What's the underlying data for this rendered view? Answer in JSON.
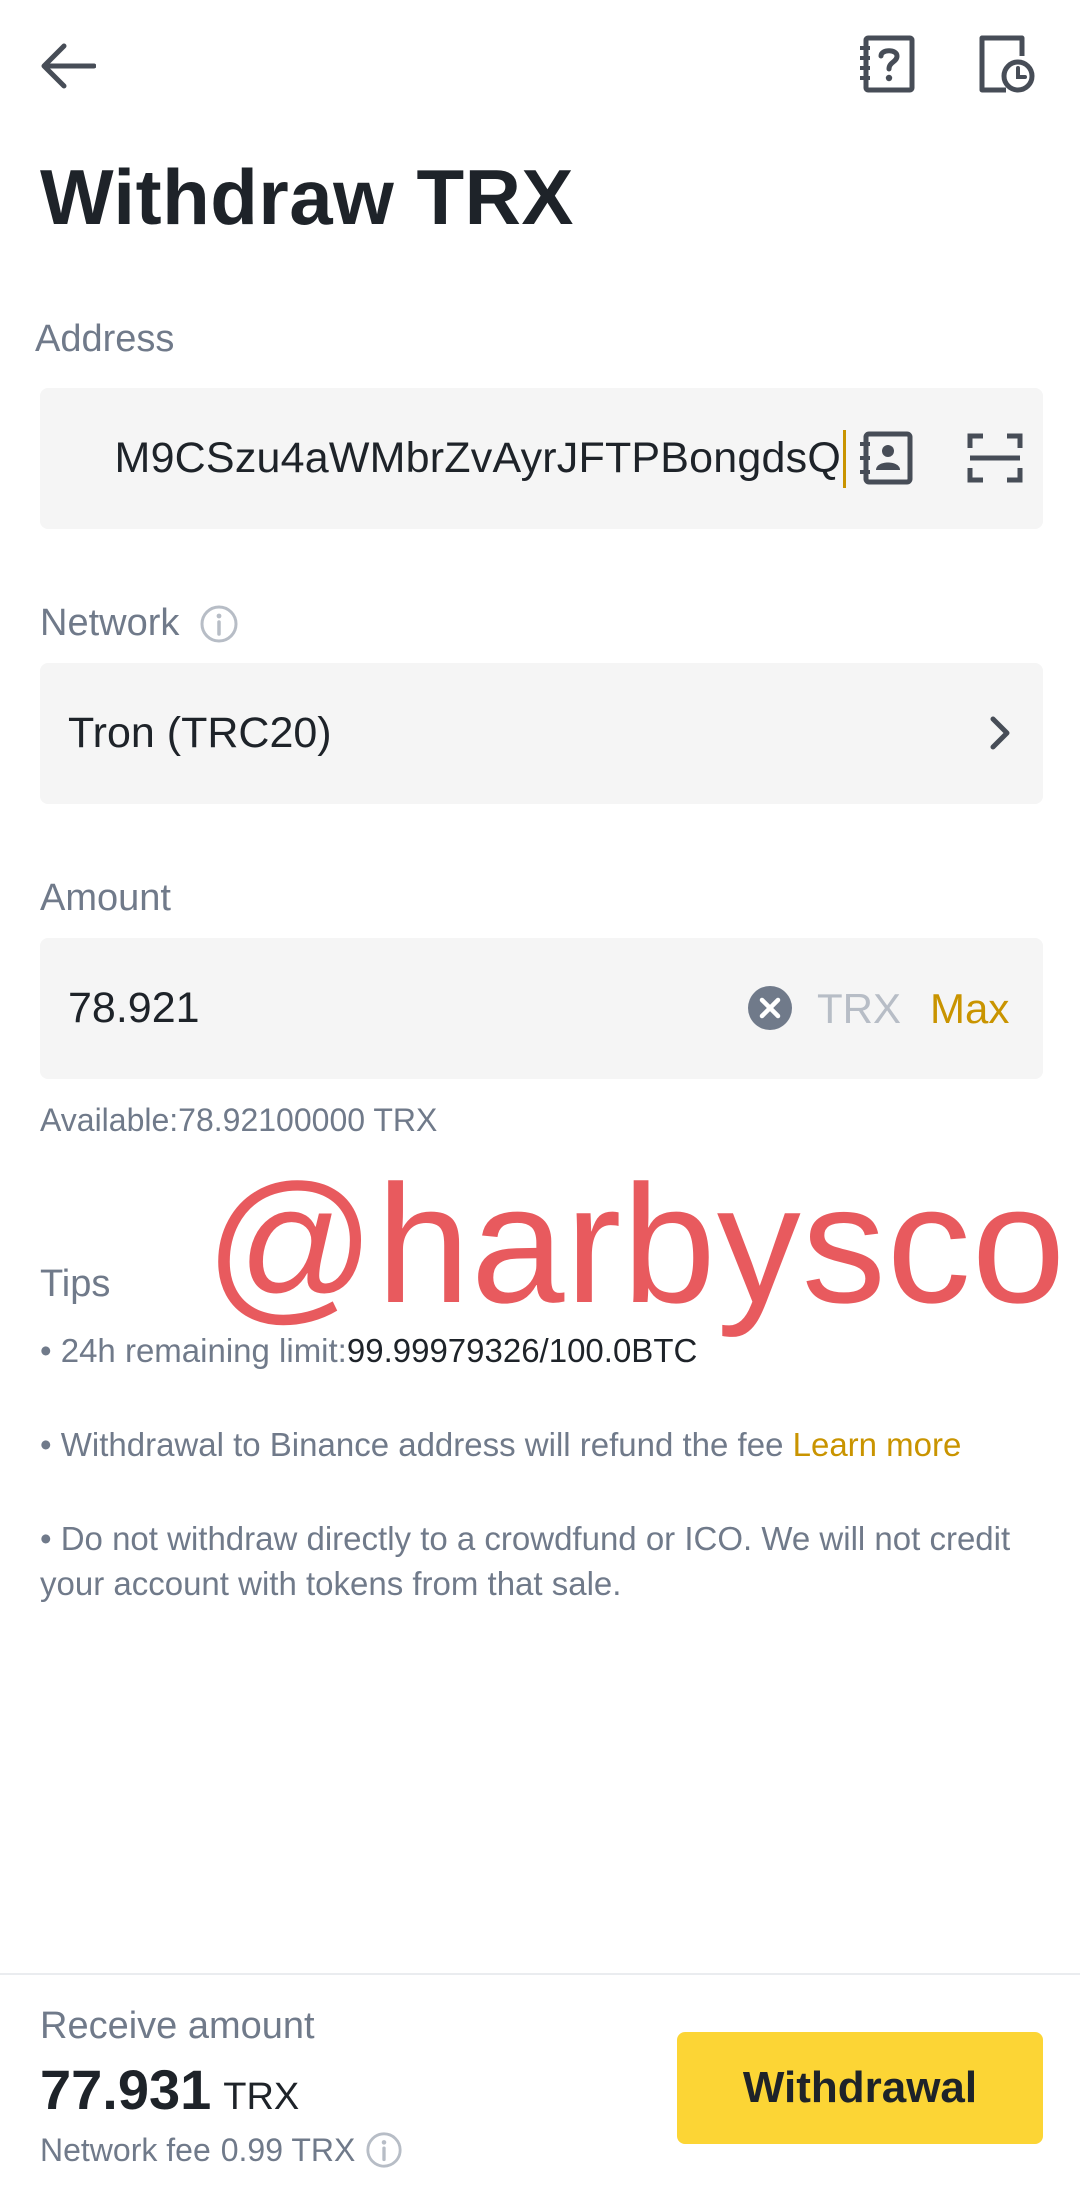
{
  "header": {
    "title": "Withdraw TRX",
    "back_icon": "arrow-left-icon",
    "help_icon": "help-doc-icon",
    "history_icon": "history-icon"
  },
  "address": {
    "label": "Address",
    "value": "M9CSzu4aWMbrZvAyrJFTPBongdsQ",
    "contact_icon": "address-book-icon",
    "scan_icon": "scan-icon"
  },
  "network": {
    "label": "Network",
    "value": "Tron (TRC20)",
    "info_icon": "info-icon"
  },
  "amount": {
    "label": "Amount",
    "value": "78.921",
    "unit": "TRX",
    "max_label": "Max",
    "available": "Available:78.92100000 TRX"
  },
  "watermark": "@harbysco",
  "tips": {
    "title": "Tips",
    "limit_prefix": "• 24h remaining limit:",
    "limit_value": "99.99979326/100.0BTC",
    "refund_text": "• Withdrawal to Binance address will refund the fee ",
    "learn_more": "Learn more",
    "warning": "• Do not withdraw directly to a crowdfund or ICO. We will not credit your account with tokens from that sale."
  },
  "footer": {
    "receive_label": "Receive amount",
    "receive_value": "77.931",
    "receive_unit": "TRX",
    "fee_label": "Network fee",
    "fee_value": "0.99 TRX",
    "withdraw_label": "Withdrawal"
  },
  "colors": {
    "accent": "#fcd535",
    "link": "#c99400",
    "text": "#1e2329",
    "muted": "#707a8a",
    "field_bg": "#f5f5f5",
    "watermark": "#e85a5e"
  }
}
